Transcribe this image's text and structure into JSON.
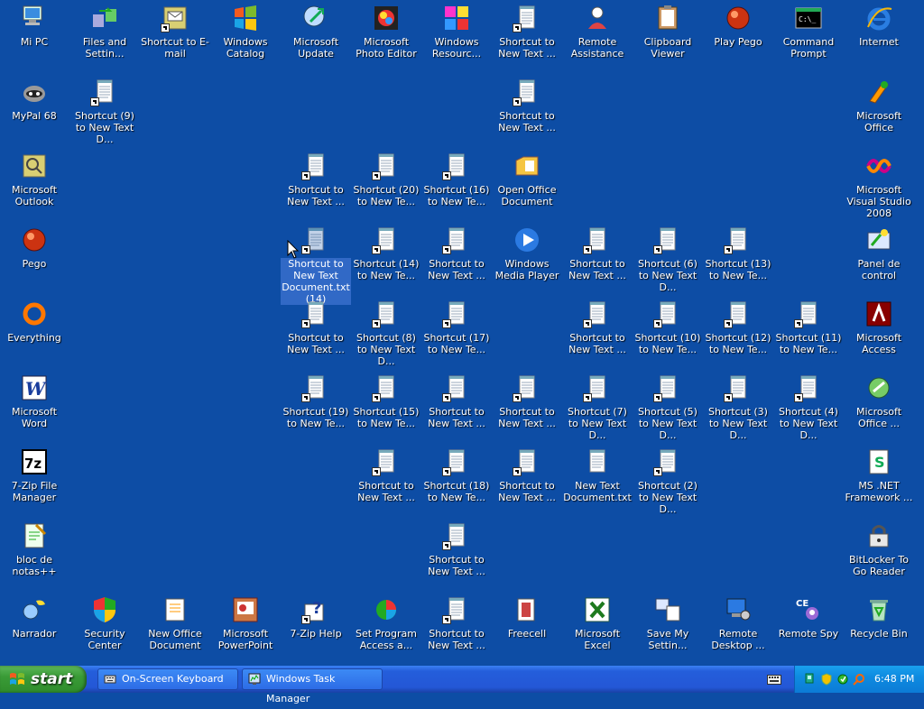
{
  "desktop": {
    "icons": [
      {
        "label": "Mi PC",
        "icon": "computer-icon",
        "shortcut": false
      },
      {
        "label": "Files and Settin...",
        "icon": "transfer-icon",
        "shortcut": false
      },
      {
        "label": "Shortcut to E-mail",
        "icon": "email-icon",
        "shortcut": true
      },
      {
        "label": "Windows Catalog",
        "icon": "windows-logo-icon",
        "shortcut": false
      },
      {
        "label": "Microsoft Update",
        "icon": "update-icon",
        "shortcut": false
      },
      {
        "label": "Microsoft Photo Editor",
        "icon": "photo-editor-icon",
        "shortcut": false
      },
      {
        "label": "Windows Resourc...",
        "icon": "resources-icon",
        "shortcut": false
      },
      {
        "label": "Shortcut to New Text ...",
        "icon": "notepad-icon",
        "shortcut": true
      },
      {
        "label": "Remote Assistance",
        "icon": "remote-assistance-icon",
        "shortcut": false
      },
      {
        "label": "Clipboard Viewer",
        "icon": "clipboard-icon",
        "shortcut": false
      },
      {
        "label": "Play Pego",
        "icon": "pego-icon",
        "shortcut": false
      },
      {
        "label": "Command Prompt",
        "icon": "cmd-icon",
        "shortcut": false
      },
      {
        "label": "Internet",
        "icon": "internet-explorer-icon",
        "shortcut": false
      },
      {
        "label": "MyPal 68",
        "icon": "mypal-icon",
        "shortcut": false
      },
      {
        "label": "Shortcut (9) to New Text D...",
        "icon": "notepad-icon",
        "shortcut": true
      },
      {
        "label": "Shortcut to New Text ...",
        "icon": "notepad-icon",
        "shortcut": true
      },
      {
        "label": "Microsoft Office",
        "icon": "office-icon",
        "shortcut": false
      },
      {
        "label": "Microsoft Outlook",
        "icon": "outlook-icon",
        "shortcut": false
      },
      {
        "label": "Shortcut to New Text ...",
        "icon": "notepad-icon",
        "shortcut": true
      },
      {
        "label": "Shortcut (20) to New Te...",
        "icon": "notepad-icon",
        "shortcut": true
      },
      {
        "label": "Shortcut (16) to New Te...",
        "icon": "notepad-icon",
        "shortcut": true
      },
      {
        "label": "Open Office Document",
        "icon": "open-office-icon",
        "shortcut": false
      },
      {
        "label": "Microsoft Visual Studio 2008",
        "icon": "visual-studio-icon",
        "shortcut": false
      },
      {
        "label": "Pego",
        "icon": "pego-icon",
        "shortcut": false
      },
      {
        "label": "Shortcut to New Text Document.txt (14)",
        "icon": "notepad-icon",
        "shortcut": true,
        "selected": true
      },
      {
        "label": "Shortcut (14) to New Te...",
        "icon": "notepad-icon",
        "shortcut": true
      },
      {
        "label": "Shortcut to New Text ...",
        "icon": "notepad-icon",
        "shortcut": true
      },
      {
        "label": "Windows Media Player",
        "icon": "media-player-icon",
        "shortcut": false
      },
      {
        "label": "Shortcut to New Text ...",
        "icon": "notepad-icon",
        "shortcut": true
      },
      {
        "label": "Shortcut (6) to New Text D...",
        "icon": "notepad-icon",
        "shortcut": true
      },
      {
        "label": "Shortcut (13) to New Te...",
        "icon": "notepad-icon",
        "shortcut": true
      },
      {
        "label": "Panel de control",
        "icon": "control-panel-icon",
        "shortcut": false
      },
      {
        "label": "Everything",
        "icon": "everything-icon",
        "shortcut": false
      },
      {
        "label": "Shortcut to New Text ...",
        "icon": "notepad-icon",
        "shortcut": true
      },
      {
        "label": "Shortcut (8) to New Text D...",
        "icon": "notepad-icon",
        "shortcut": true
      },
      {
        "label": "Shortcut (17) to New Te...",
        "icon": "notepad-icon",
        "shortcut": true
      },
      {
        "label": "Shortcut to New Text ...",
        "icon": "notepad-icon",
        "shortcut": true
      },
      {
        "label": "Shortcut (10) to New Te...",
        "icon": "notepad-icon",
        "shortcut": true
      },
      {
        "label": "Shortcut (12) to New Te...",
        "icon": "notepad-icon",
        "shortcut": true
      },
      {
        "label": "Shortcut (11) to New Te...",
        "icon": "notepad-icon",
        "shortcut": true
      },
      {
        "label": "Microsoft Access",
        "icon": "access-icon",
        "shortcut": false
      },
      {
        "label": "Microsoft Word",
        "icon": "word-icon",
        "shortcut": false
      },
      {
        "label": "Shortcut (19) to New Te...",
        "icon": "notepad-icon",
        "shortcut": true
      },
      {
        "label": "Shortcut (15) to New Te...",
        "icon": "notepad-icon",
        "shortcut": true
      },
      {
        "label": "Shortcut to New Text ...",
        "icon": "notepad-icon",
        "shortcut": true
      },
      {
        "label": "Shortcut to New Text ...",
        "icon": "notepad-icon",
        "shortcut": true
      },
      {
        "label": "Shortcut (7) to New Text D...",
        "icon": "notepad-icon",
        "shortcut": true
      },
      {
        "label": "Shortcut (5) to New Text D...",
        "icon": "notepad-icon",
        "shortcut": true
      },
      {
        "label": "Shortcut (3) to New Text D...",
        "icon": "notepad-icon",
        "shortcut": true
      },
      {
        "label": "Shortcut (4) to New Text D...",
        "icon": "notepad-icon",
        "shortcut": true
      },
      {
        "label": "Microsoft Office ...",
        "icon": "office-tools-icon",
        "shortcut": false
      },
      {
        "label": "7-Zip File Manager",
        "icon": "7zip-icon",
        "shortcut": false
      },
      {
        "label": "Shortcut to New Text ...",
        "icon": "notepad-icon",
        "shortcut": true
      },
      {
        "label": "Shortcut (18) to New Te...",
        "icon": "notepad-icon",
        "shortcut": true
      },
      {
        "label": "Shortcut to New Text ...",
        "icon": "notepad-icon",
        "shortcut": true
      },
      {
        "label": "New Text Document.txt",
        "icon": "notepad-icon",
        "shortcut": false
      },
      {
        "label": "Shortcut (2) to New Text D...",
        "icon": "notepad-icon",
        "shortcut": true
      },
      {
        "label": "MS .NET Framework ...",
        "icon": "dotnet-icon",
        "shortcut": false
      },
      {
        "label": "bloc de notas++",
        "icon": "notepadpp-icon",
        "shortcut": false
      },
      {
        "label": "Shortcut to New Text ...",
        "icon": "notepad-icon",
        "shortcut": true
      },
      {
        "label": "BitLocker To Go Reader",
        "icon": "bitlocker-icon",
        "shortcut": false
      },
      {
        "label": "Narrador",
        "icon": "narrator-icon",
        "shortcut": false
      },
      {
        "label": "Security Center",
        "icon": "security-center-icon",
        "shortcut": false
      },
      {
        "label": "New Office Document",
        "icon": "new-office-icon",
        "shortcut": false
      },
      {
        "label": "Microsoft PowerPoint",
        "icon": "powerpoint-icon",
        "shortcut": false
      },
      {
        "label": "7-Zip Help",
        "icon": "help-icon",
        "shortcut": true
      },
      {
        "label": "Set Program Access a...",
        "icon": "program-access-icon",
        "shortcut": false
      },
      {
        "label": "Shortcut to New Text ...",
        "icon": "notepad-icon",
        "shortcut": true
      },
      {
        "label": "Freecell",
        "icon": "freecell-icon",
        "shortcut": false
      },
      {
        "label": "Microsoft Excel",
        "icon": "excel-icon",
        "shortcut": false
      },
      {
        "label": "Save My Settin...",
        "icon": "save-settings-icon",
        "shortcut": false
      },
      {
        "label": "Remote Desktop ...",
        "icon": "remote-desktop-icon",
        "shortcut": false
      },
      {
        "label": "Remote Spy",
        "icon": "remote-spy-icon",
        "shortcut": false
      },
      {
        "label": "Recycle Bin",
        "icon": "recycle-bin-icon",
        "shortcut": false
      }
    ]
  },
  "taskbar": {
    "start_label": "start",
    "tasks": [
      {
        "label": "On-Screen Keyboard",
        "icon": "keyboard-icon"
      },
      {
        "label": "Windows Task Manager",
        "icon": "task-manager-icon"
      }
    ],
    "clock": "6:48 PM",
    "tray_icons": [
      "network-icon",
      "shield-icon",
      "security-icon",
      "search-icon"
    ]
  }
}
